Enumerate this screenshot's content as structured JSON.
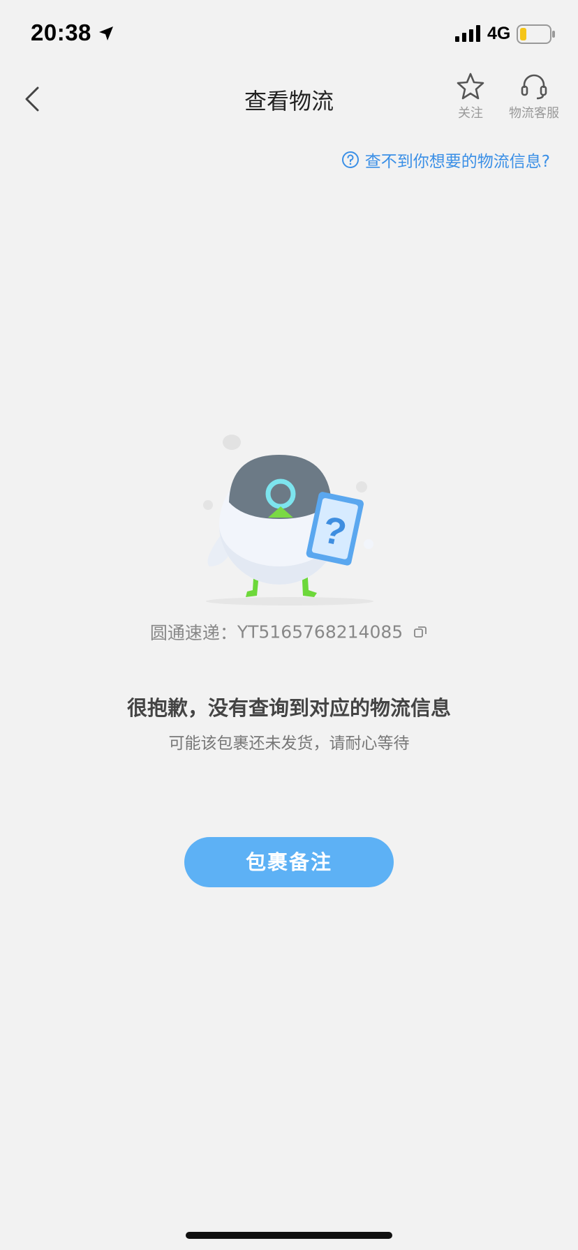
{
  "status_bar": {
    "time": "20:38",
    "network": "4G",
    "battery_color": "#f5c518"
  },
  "nav": {
    "title": "查看物流",
    "follow_label": "关注",
    "service_label": "物流客服"
  },
  "help": {
    "text": "查不到你想要的物流信息?"
  },
  "tracking": {
    "carrier_label": "圆通速递：",
    "tracking_number": "YT5165768214085"
  },
  "empty_state": {
    "title": "很抱歉，没有查询到对应的物流信息",
    "subtitle": "可能该包裹还未发货，请耐心等待"
  },
  "actions": {
    "note_button": "包裹备注"
  },
  "colors": {
    "accent": "#5db1f5",
    "link": "#3a8fe6",
    "background": "#f2f2f2"
  },
  "icons": {
    "back": "chevron-left-icon",
    "follow": "star-icon",
    "service": "headset-icon",
    "help": "question-circle-icon",
    "copy": "copy-icon",
    "location": "location-arrow-icon",
    "signal": "signal-icon",
    "battery": "battery-icon"
  }
}
